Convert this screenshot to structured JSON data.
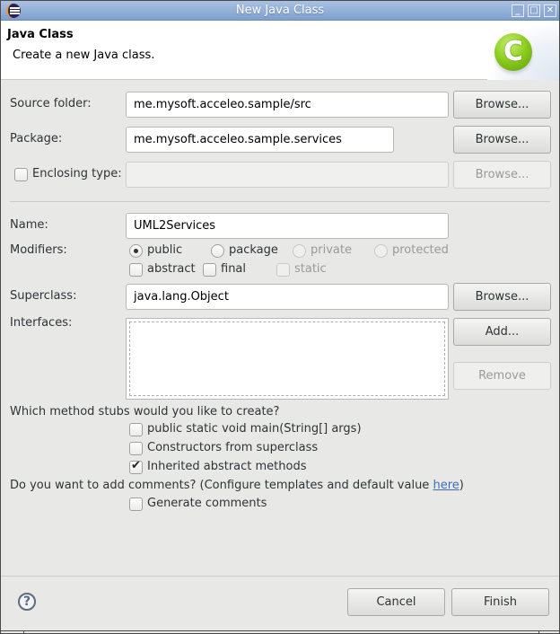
{
  "window": {
    "title": "New Java Class",
    "controls": {
      "minimize": "_",
      "maximize": "□",
      "close": "✕"
    }
  },
  "header": {
    "title": "Java Class",
    "description": "Create a new Java class.",
    "icon": "java-class-c-icon",
    "icon_glyph": "C"
  },
  "form": {
    "source_folder": {
      "label": "Source folder:",
      "value": "me.mysoft.acceleo.sample/src",
      "browse": "Browse..."
    },
    "package": {
      "label": "Package:",
      "value": "me.mysoft.acceleo.sample.services",
      "browse": "Browse..."
    },
    "enclosing_type": {
      "label": "Enclosing type:",
      "checked": false,
      "value": "",
      "browse": "Browse...",
      "enabled": false
    },
    "name": {
      "label": "Name:",
      "value": "UML2Services"
    },
    "modifiers": {
      "label": "Modifiers:",
      "visibility": [
        {
          "label": "public",
          "selected": true,
          "enabled": true
        },
        {
          "label": "package",
          "selected": false,
          "enabled": true
        },
        {
          "label": "private",
          "selected": false,
          "enabled": false
        },
        {
          "label": "protected",
          "selected": false,
          "enabled": false
        }
      ],
      "flags": [
        {
          "label": "abstract",
          "checked": false,
          "enabled": true
        },
        {
          "label": "final",
          "checked": false,
          "enabled": true
        },
        {
          "label": "static",
          "checked": false,
          "enabled": false
        }
      ]
    },
    "superclass": {
      "label": "Superclass:",
      "value": "java.lang.Object",
      "browse": "Browse..."
    },
    "interfaces": {
      "label": "Interfaces:",
      "items": [],
      "add": "Add...",
      "remove": "Remove"
    },
    "method_stubs": {
      "question": "Which method stubs would you like to create?",
      "options": [
        {
          "label": "public static void main(String[] args)",
          "checked": false
        },
        {
          "label": "Constructors from superclass",
          "checked": false
        },
        {
          "label": "Inherited abstract methods",
          "checked": true
        }
      ]
    },
    "comments": {
      "question_prefix": "Do you want to add comments? (Configure templates and default value ",
      "link": "here",
      "question_suffix": ")",
      "option": {
        "label": "Generate comments",
        "checked": false
      }
    }
  },
  "footer": {
    "help_glyph": "?",
    "cancel": "Cancel",
    "finish": "Finish"
  },
  "colors": {
    "titlebar": "#7ea0cf",
    "link": "#3b6fb6",
    "dialog_bg": "#e8e8e7",
    "class_icon_green": "#8fcf1f"
  }
}
